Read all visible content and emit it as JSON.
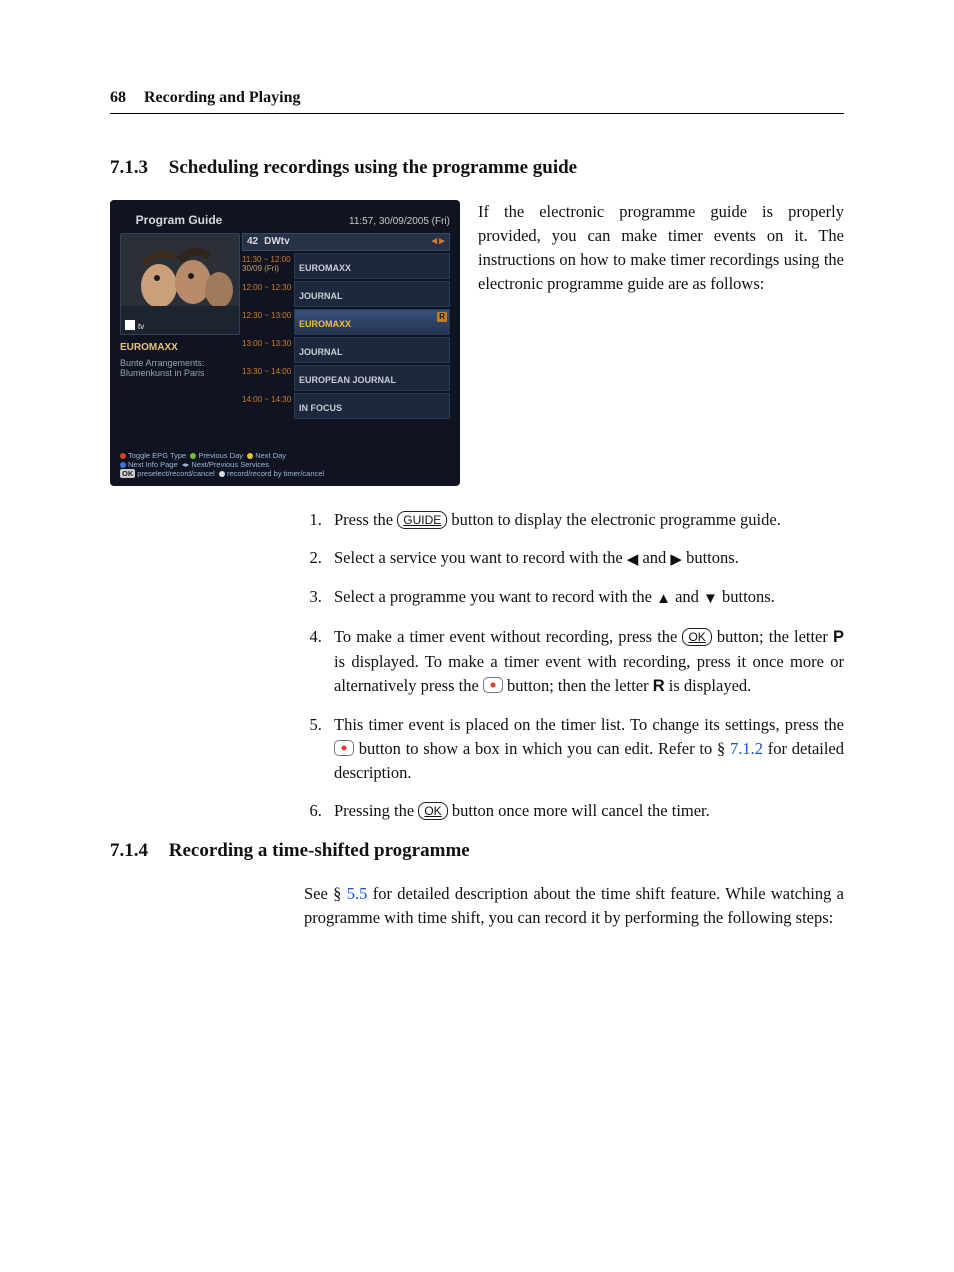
{
  "header": {
    "page_number": "68",
    "chapter_title": "Recording and Playing"
  },
  "section1": {
    "number": "7.1.3",
    "title": "Scheduling recordings using the programme guide"
  },
  "sidepara": "If the electronic programme guide is properly provided, you can make timer events on it. The instructions on how to make timer recordings using the electronic programme guide are as follows:",
  "epg": {
    "title": "Program Guide",
    "clock": "11:57, 30/09/2005 (Fri)",
    "channel_number": "42",
    "channel_name": "DWtv",
    "arrows": "◄►",
    "current_prog_name": "EUROMAXX",
    "current_prog_sub": "Bunte Arrangements:\nBlumenkunst in Paris",
    "rows": [
      {
        "time_top": "11:30 ~ 12:00",
        "time_sub": "30/09 (Fri)",
        "title": "EUROMAXX",
        "hl": false,
        "badge": ""
      },
      {
        "time_top": "12:00 ~ 12:30",
        "time_sub": "",
        "title": "JOURNAL",
        "hl": false,
        "badge": ""
      },
      {
        "time_top": "12:30 ~ 13:00",
        "time_sub": "",
        "title": "EUROMAXX",
        "hl": true,
        "badge": "R"
      },
      {
        "time_top": "13:00 ~ 13:30",
        "time_sub": "",
        "title": "JOURNAL",
        "hl": false,
        "badge": ""
      },
      {
        "time_top": "13:30 ~ 14:00",
        "time_sub": "",
        "title": "EUROPEAN JOURNAL",
        "hl": false,
        "badge": ""
      },
      {
        "time_top": "14:00 ~ 14:30",
        "time_sub": "",
        "title": "IN FOCUS",
        "hl": false,
        "badge": ""
      }
    ],
    "footer": {
      "toggle": "Toggle EPG Type",
      "prevday": "Previous Day",
      "nextday": "Next Day",
      "nextinfo": "Next Info Page",
      "nps": "Next/Previous Services",
      "ok_label": "OK",
      "ok_text": "preselect/record/cancel",
      "rec": "record/record by timer/cancel"
    }
  },
  "steps": {
    "s1a": "Press the ",
    "s1_key": "GUIDE",
    "s1b": " button to display the electronic programme guide.",
    "s2a": "Select a service you want to record with the ",
    "s2b": " and ",
    "s2c": " buttons.",
    "s3a": "Select a programme you want to record with the ",
    "s3b": " and ",
    "s3c": " buttons.",
    "s4a": "To make a timer event without recording, press the ",
    "s4_key1": "OK",
    "s4b": " button; the letter ",
    "s4_P": "P",
    "s4c": " is displayed. To make a timer event with recording, press it once more or alternatively press the ",
    "s4d": " button; then the letter ",
    "s4_R": "R",
    "s4e": " is displayed.",
    "s5a": "This timer event is placed on the timer list. To change its settings, press the ",
    "s5b": " button to show a box in which you can edit. Refer to § ",
    "s5_ref": "7.1.2",
    "s5c": " for detailed description.",
    "s6a": "Pressing the ",
    "s6_key": "OK",
    "s6b": " button once more will cancel the timer."
  },
  "section2": {
    "number": "7.1.4",
    "title": "Recording a time-shifted programme"
  },
  "para2a": "See § ",
  "para2_ref": "5.5",
  "para2b": " for detailed description about the time shift feature. While watching a programme with time shift, you can record it by performing the following steps:"
}
